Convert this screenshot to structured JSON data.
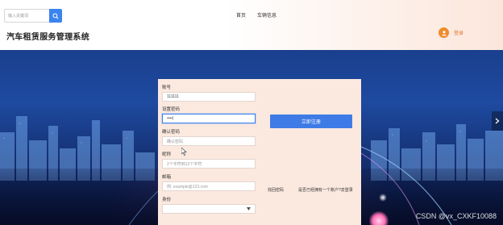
{
  "header": {
    "search": {
      "placeholder": "输入关键词"
    },
    "nav": [
      "首页",
      "车辆信息"
    ],
    "site_title": "汽车租赁服务管理系统",
    "login_label": "登录"
  },
  "form": {
    "account": {
      "label": "账号",
      "value": "111111"
    },
    "password": {
      "label": "设置密码",
      "value": "••••|"
    },
    "confirm": {
      "label": "确认密码",
      "placeholder": "确认密码"
    },
    "nickname": {
      "label": "昵称",
      "placeholder": "2个字符到12个字符"
    },
    "email": {
      "label": "邮箱",
      "placeholder": "例: example@123.com"
    },
    "identity": {
      "label": "身份",
      "value": ""
    },
    "register_button": "立即注册",
    "forgot_link": "找回密码",
    "login_link": "是否已经拥有一个账户?去登录"
  },
  "watermark": "CSDN @vx_CXKF10088",
  "colors": {
    "primary": "#3f7be6",
    "accent": "#f08a2a",
    "card_bg": "#fbe9e0"
  }
}
